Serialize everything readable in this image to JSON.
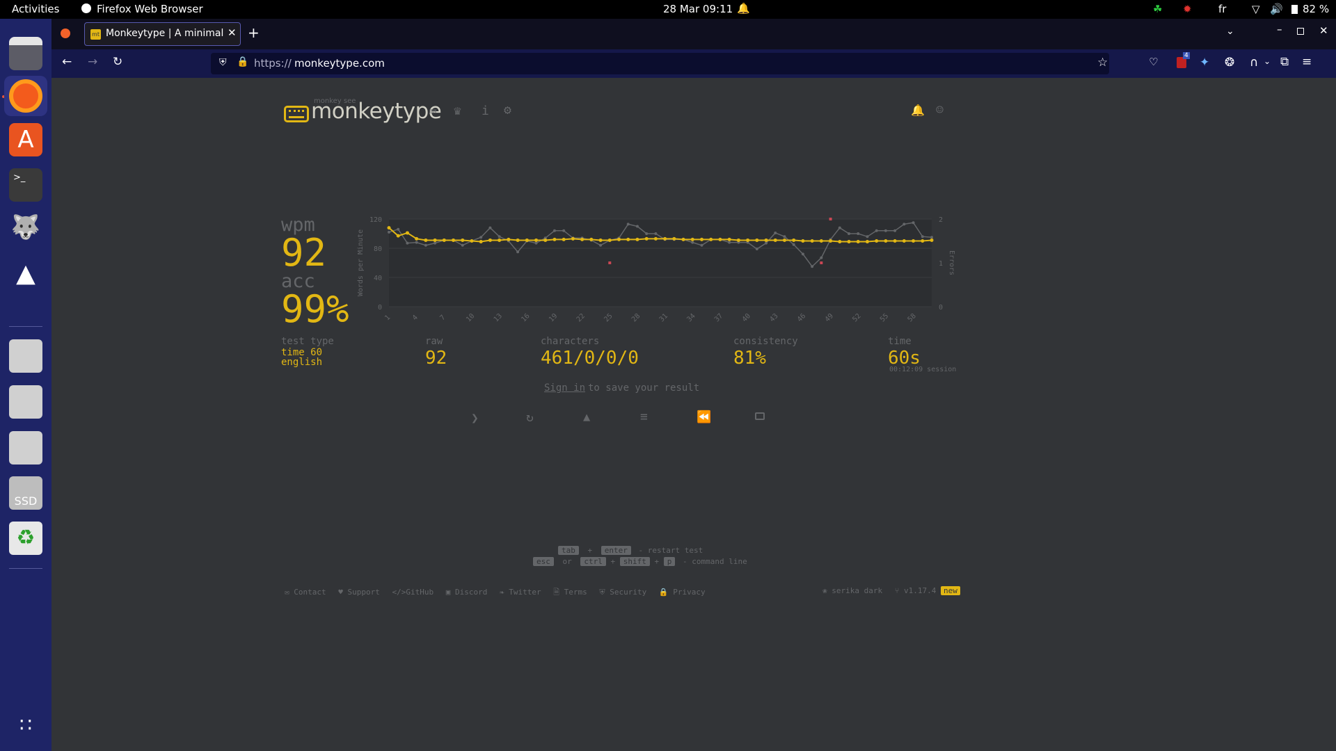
{
  "topbar": {
    "activities": "Activities",
    "app_name": "Firefox Web Browser",
    "datetime": "28 Mar  09:11",
    "lang": "fr",
    "battery": "82 %"
  },
  "browser": {
    "tab_title": "Monkeytype | A minimalis",
    "url_scheme": "https://",
    "url_host": "monkeytype.com",
    "ext_badge": "4"
  },
  "header": {
    "tagline": "monkey see",
    "logo_text": "monkeytype"
  },
  "result": {
    "wpm_label": "wpm",
    "wpm_value": "92",
    "acc_label": "acc",
    "acc_value": "99%",
    "test_type_label": "test type",
    "test_type_line1": "time 60",
    "test_type_line2": "english",
    "raw_label": "raw",
    "raw_value": "92",
    "chars_label": "characters",
    "chars_value": "461/0/0/0",
    "consistency_label": "consistency",
    "consistency_value": "81%",
    "time_label": "time",
    "time_value": "60s",
    "session_text": "00:12:09 session",
    "sign_in_link": "Sign in",
    "sign_in_rest": "to save your result"
  },
  "shortcuts": {
    "key_tab": "tab",
    "plus": "+",
    "key_enter": "enter",
    "restart_text": "- restart test",
    "key_esc": "esc",
    "or": "or",
    "key_ctrl": "ctrl",
    "key_shift": "shift",
    "key_p": "p",
    "command_text": "- command line"
  },
  "footer": {
    "links": [
      "Contact",
      "Support",
      "GitHub",
      "Discord",
      "Twitter",
      "Terms",
      "Security",
      "Privacy"
    ],
    "theme": "serika dark",
    "version": "v1.17.4",
    "new_badge": "new"
  },
  "colors": {
    "bg": "#323437",
    "accent": "#e2b714",
    "sub": "#646669",
    "error": "#ca4754"
  },
  "chart_data": {
    "type": "line",
    "ylabel": "Words per Minute",
    "y2label": "Errors",
    "ylim": [
      0,
      120
    ],
    "y2lim": [
      0,
      2
    ],
    "y_ticks": [
      "0",
      "40",
      "80",
      "120"
    ],
    "y2_ticks": [
      "0",
      "1",
      "2"
    ],
    "x_ticks": [
      "1",
      "4",
      "7",
      "10",
      "13",
      "16",
      "19",
      "22",
      "25",
      "28",
      "31",
      "34",
      "37",
      "40",
      "43",
      "46",
      "49",
      "52",
      "55",
      "58"
    ],
    "x": [
      1,
      2,
      3,
      4,
      5,
      6,
      7,
      8,
      9,
      10,
      11,
      12,
      13,
      14,
      15,
      16,
      17,
      18,
      19,
      20,
      21,
      22,
      23,
      24,
      25,
      26,
      27,
      28,
      29,
      30,
      31,
      32,
      33,
      34,
      35,
      36,
      37,
      38,
      39,
      40,
      41,
      42,
      43,
      44,
      45,
      46,
      47,
      48,
      49,
      50,
      51,
      52,
      53,
      54,
      55,
      56,
      57,
      58,
      59,
      60
    ],
    "series": [
      {
        "name": "wpm",
        "color": "#e2b714",
        "values": [
          108,
          97,
          101,
          93,
          91,
          91,
          91,
          91,
          91,
          90,
          89,
          91,
          91,
          92,
          91,
          91,
          91,
          91,
          92,
          92,
          93,
          92,
          92,
          91,
          91,
          92,
          92,
          92,
          93,
          93,
          93,
          93,
          92,
          92,
          92,
          92,
          92,
          92,
          91,
          91,
          91,
          91,
          91,
          91,
          91,
          90,
          90,
          90,
          90,
          89,
          89,
          89,
          89,
          90,
          90,
          90,
          90,
          90,
          90,
          91
        ]
      },
      {
        "name": "raw",
        "color": "#646669",
        "values": [
          102,
          106,
          87,
          88,
          84,
          87,
          91,
          91,
          84,
          90,
          95,
          108,
          96,
          90,
          75,
          90,
          87,
          94,
          104,
          104,
          94,
          94,
          91,
          84,
          91,
          94,
          113,
          110,
          100,
          100,
          92,
          92,
          92,
          88,
          84,
          92,
          92,
          88,
          88,
          88,
          79,
          87,
          101,
          96,
          85,
          72,
          55,
          67,
          92,
          108,
          100,
          100,
          96,
          104,
          104,
          104,
          113,
          115,
          96,
          95
        ]
      }
    ],
    "errors": {
      "name": "errors",
      "color": "#ca4754",
      "points": [
        {
          "x": 25,
          "y": 1
        },
        {
          "x": 48,
          "y": 1
        },
        {
          "x": 49,
          "y": 2
        }
      ]
    }
  }
}
